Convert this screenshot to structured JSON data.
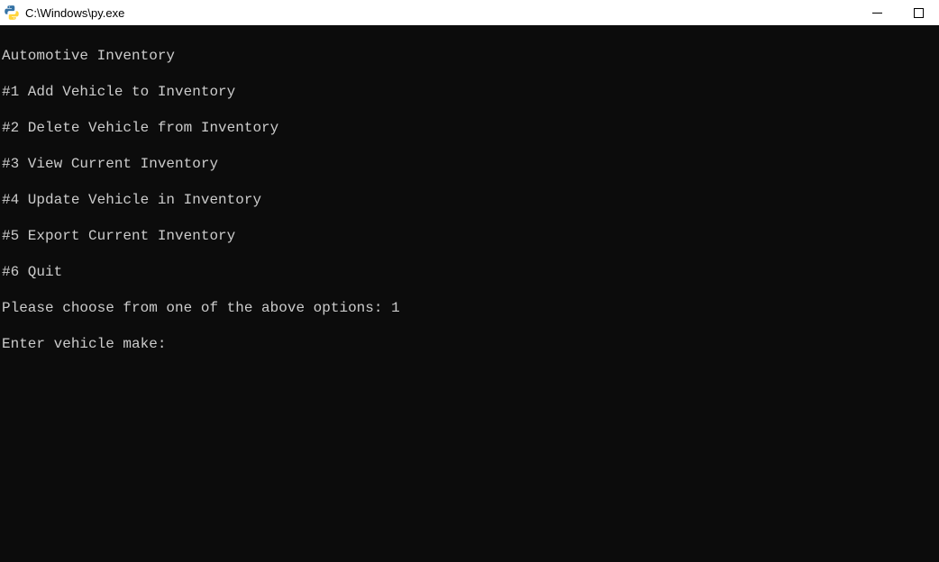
{
  "window": {
    "title": "C:\\Windows\\py.exe"
  },
  "terminal": {
    "lines": [
      "Automotive Inventory",
      "#1 Add Vehicle to Inventory",
      "#2 Delete Vehicle from Inventory",
      "#3 View Current Inventory",
      "#4 Update Vehicle in Inventory",
      "#5 Export Current Inventory",
      "#6 Quit"
    ],
    "prompt1_label": "Please choose from one of the above options: ",
    "prompt1_value": "1",
    "prompt2_label": "Enter vehicle make: ",
    "prompt2_value": ""
  }
}
